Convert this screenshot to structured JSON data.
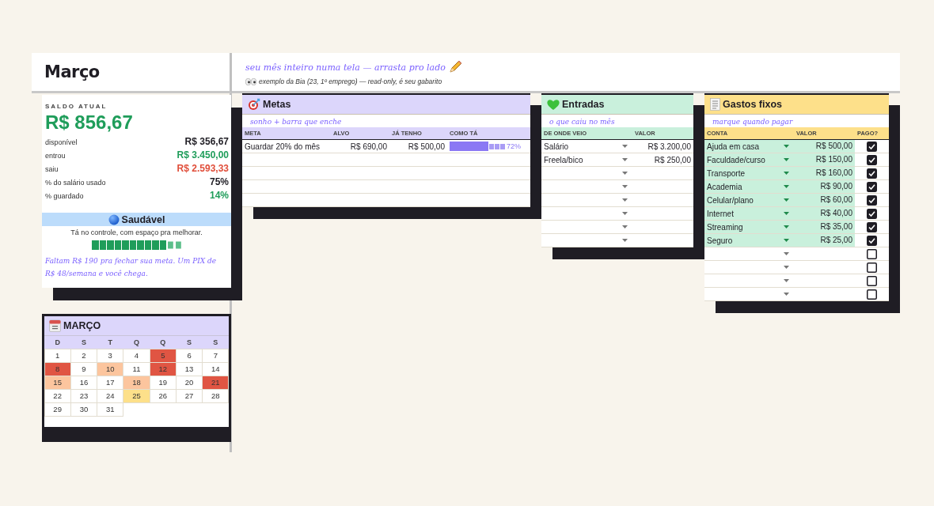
{
  "sheet_title": "Março",
  "tagline": "seu mês inteiro numa tela — arrasta pro lado",
  "note": "exemplo da Bia (23, 1º emprego) — read-only, é seu gabarito",
  "balance": {
    "label": "SALDO ATUAL",
    "amount": "R$ 856,67",
    "lines": [
      {
        "label": "disponível",
        "value": "R$ 356,67",
        "color": "#1f1d24"
      },
      {
        "label": "entrou",
        "value": "R$ 3.450,00",
        "color": "#1f9d5a"
      },
      {
        "label": "saiu",
        "value": "R$ 2.593,33",
        "color": "#e04e3a"
      },
      {
        "label": "% do salário usado",
        "value": "75%",
        "color": "#1f1d24"
      },
      {
        "label": "% guardado",
        "value": "14%",
        "color": "#1f9d5a"
      }
    ],
    "status": "Saudável",
    "status_text": "Tá no controle, com espaço pra melhorar.",
    "level": 0.83,
    "tip": "Faltam R$ 190 pra fechar sua meta. Um PIX de R$ 48/semana e você chega."
  },
  "calendar": {
    "title": "MARÇO",
    "weekdays": [
      "D",
      "S",
      "T",
      "Q",
      "Q",
      "S",
      "S"
    ],
    "days": [
      {
        "day": "1"
      },
      {
        "day": "2"
      },
      {
        "day": "3"
      },
      {
        "day": "4"
      },
      {
        "day": "5",
        "color": "#e05543"
      },
      {
        "day": "6"
      },
      {
        "day": "7"
      },
      {
        "day": "8",
        "color": "#e05543"
      },
      {
        "day": "9"
      },
      {
        "day": "10",
        "color": "#fcc59e"
      },
      {
        "day": "11"
      },
      {
        "day": "12",
        "color": "#e05543"
      },
      {
        "day": "13"
      },
      {
        "day": "14"
      },
      {
        "day": "15",
        "color": "#fcc59e"
      },
      {
        "day": "16"
      },
      {
        "day": "17"
      },
      {
        "day": "18",
        "color": "#fcc59e"
      },
      {
        "day": "19"
      },
      {
        "day": "20"
      },
      {
        "day": "21",
        "color": "#e05543"
      },
      {
        "day": "22"
      },
      {
        "day": "23"
      },
      {
        "day": "24"
      },
      {
        "day": "25",
        "color": "#fde08a"
      },
      {
        "day": "26"
      },
      {
        "day": "27"
      },
      {
        "day": "28"
      },
      {
        "day": "29"
      },
      {
        "day": "30"
      },
      {
        "day": "31"
      }
    ]
  },
  "goals": {
    "title": "Metas",
    "subtitle": "sonho + barra que enche",
    "columns": [
      "META",
      "ALVO",
      "JÁ TENHO",
      "COMO TÁ"
    ],
    "rows": [
      {
        "goal": "Guardar 20% do mês",
        "target": "R$ 690,00",
        "saved": "R$ 500,00",
        "level": 0.72,
        "percent": "72%"
      },
      {},
      {},
      {},
      {}
    ]
  },
  "income": {
    "title": "Entradas",
    "subtitle": "o que caiu no mês",
    "columns": [
      "DE ONDE VEIO",
      "VALOR"
    ],
    "rows": [
      {
        "source": "Salário",
        "value": "R$ 3.200,00"
      },
      {
        "source": "Freela/bico",
        "value": "R$ 250,00"
      },
      {},
      {},
      {},
      {},
      {},
      {}
    ]
  },
  "fixed": {
    "title": "Gastos fixos",
    "subtitle": "marque quando pagar",
    "columns": [
      "CONTA",
      "VALOR",
      "PAGO?"
    ],
    "rows": [
      {
        "bill": "Ajuda em casa",
        "value": "R$ 500,00",
        "checked": true
      },
      {
        "bill": "Faculdade/curso",
        "value": "R$ 150,00",
        "checked": true
      },
      {
        "bill": "Transporte",
        "value": "R$ 160,00",
        "checked": true
      },
      {
        "bill": "Academia",
        "value": "R$ 90,00",
        "checked": true
      },
      {
        "bill": "Celular/plano",
        "value": "R$ 60,00",
        "checked": true
      },
      {
        "bill": "Internet",
        "value": "R$ 40,00",
        "checked": true
      },
      {
        "bill": "Streaming",
        "value": "R$ 35,00",
        "checked": true
      },
      {
        "bill": "Seguro",
        "value": "R$ 25,00",
        "checked": true
      },
      {
        "checked": false
      },
      {
        "checked": false
      },
      {
        "checked": false
      },
      {
        "checked": false
      }
    ]
  }
}
